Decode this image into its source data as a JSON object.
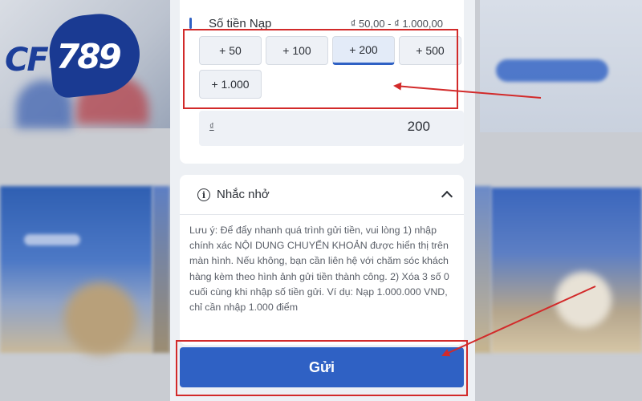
{
  "logo": {
    "prefix": "CF",
    "number": "789"
  },
  "background": {
    "small_text": ""
  },
  "deposit": {
    "title": "Số tiền Nạp",
    "range": "₫ 50,00 - ₫ 1.000,00",
    "chips": [
      "+ 50",
      "+ 100",
      "+ 200",
      "+ 500",
      "+ 1.000"
    ],
    "selected_chip": "+ 200",
    "currency_symbol": "₫",
    "amount_value": "200"
  },
  "reminder": {
    "icon_glyph": "i",
    "title": "Nhắc nhở",
    "text": "Lưu ý: Để đẩy nhanh quá trình gửi tiền, vui lòng 1) nhập chính xác NỘI DUNG CHUYỂN KHOẢN được hiển thị trên màn hình. Nếu không, bạn cần liên hệ với chăm sóc khách hàng kèm theo hình ảnh gửi tiền thành công. 2) Xóa 3 số 0 cuối cùng khi nhập số tiền gửi. Ví dụ: Nạp 1.000.000 VND, chỉ cần nhập 1.000 điểm"
  },
  "submit": {
    "label": "Gửi"
  },
  "colors": {
    "primary": "#2f61c4",
    "annotation": "#d22a2a",
    "panel_bg": "#edf0f4"
  }
}
